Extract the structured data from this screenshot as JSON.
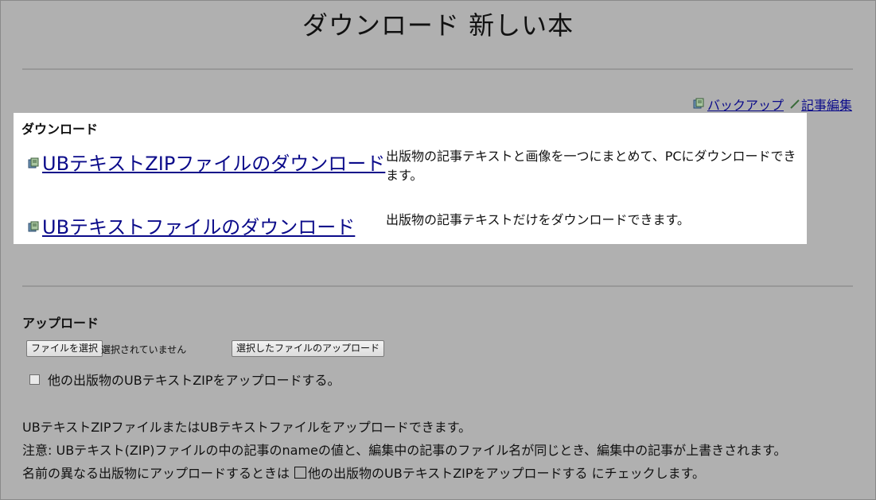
{
  "page": {
    "title": "ダウンロード 新しい本"
  },
  "topnav": {
    "backup_label": "バックアップ",
    "edit_label": "記事編集"
  },
  "download": {
    "section_title": "ダウンロード",
    "items": [
      {
        "link": "UBテキストZIPファイルのダウンロード",
        "description": "出版物の記事テキストと画像を一つにまとめて、PCにダウンロードできます。"
      },
      {
        "link": "UBテキストファイルのダウンロード",
        "description": "出版物の記事テキストだけをダウンロードできます。"
      }
    ]
  },
  "upload": {
    "section_title": "アップロード",
    "choose_button": "ファイルを選択",
    "no_file_text": "選択されていません",
    "upload_button": "選択したファイルのアップロード",
    "other_pub_checkbox": "他の出版物のUBテキストZIPをアップロードする。",
    "notes": {
      "line1": "UBテキストZIPファイルまたはUBテキストファイルをアップロードできます。",
      "line2": "注意: UBテキスト(ZIP)ファイルの中の記事のnameの値と、編集中の記事のファイル名が同じとき、編集中の記事が上書きされます。",
      "line3_a": "名前の異なる出版物にアップロードするときは",
      "line3_b": "他の出版物のUBテキストZIPをアップロードする",
      "line3_c": "にチェックします。"
    }
  },
  "colors": {
    "background": "#b0b0b0",
    "panel": "#ffffff",
    "link": "#0b0b8a",
    "pencil": "#3a6b3a"
  }
}
